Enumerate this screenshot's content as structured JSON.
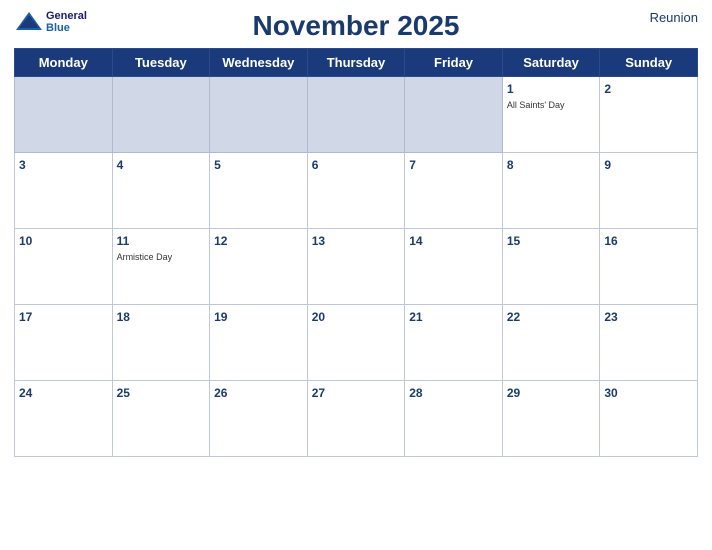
{
  "header": {
    "title": "November 2025",
    "region": "Reunion",
    "logo_line1": "General",
    "logo_line2": "Blue"
  },
  "days_of_week": [
    "Monday",
    "Tuesday",
    "Wednesday",
    "Thursday",
    "Friday",
    "Saturday",
    "Sunday"
  ],
  "weeks": [
    [
      {
        "num": "",
        "empty": true
      },
      {
        "num": "",
        "empty": true
      },
      {
        "num": "",
        "empty": true
      },
      {
        "num": "",
        "empty": true
      },
      {
        "num": "",
        "empty": true
      },
      {
        "num": "1",
        "holiday": "All Saints' Day"
      },
      {
        "num": "2"
      }
    ],
    [
      {
        "num": "3"
      },
      {
        "num": "4"
      },
      {
        "num": "5"
      },
      {
        "num": "6"
      },
      {
        "num": "7"
      },
      {
        "num": "8"
      },
      {
        "num": "9"
      }
    ],
    [
      {
        "num": "10"
      },
      {
        "num": "11",
        "holiday": "Armistice Day"
      },
      {
        "num": "12"
      },
      {
        "num": "13"
      },
      {
        "num": "14"
      },
      {
        "num": "15"
      },
      {
        "num": "16"
      }
    ],
    [
      {
        "num": "17"
      },
      {
        "num": "18"
      },
      {
        "num": "19"
      },
      {
        "num": "20"
      },
      {
        "num": "21"
      },
      {
        "num": "22"
      },
      {
        "num": "23"
      }
    ],
    [
      {
        "num": "24"
      },
      {
        "num": "25"
      },
      {
        "num": "26"
      },
      {
        "num": "27"
      },
      {
        "num": "28"
      },
      {
        "num": "29"
      },
      {
        "num": "30"
      }
    ]
  ]
}
